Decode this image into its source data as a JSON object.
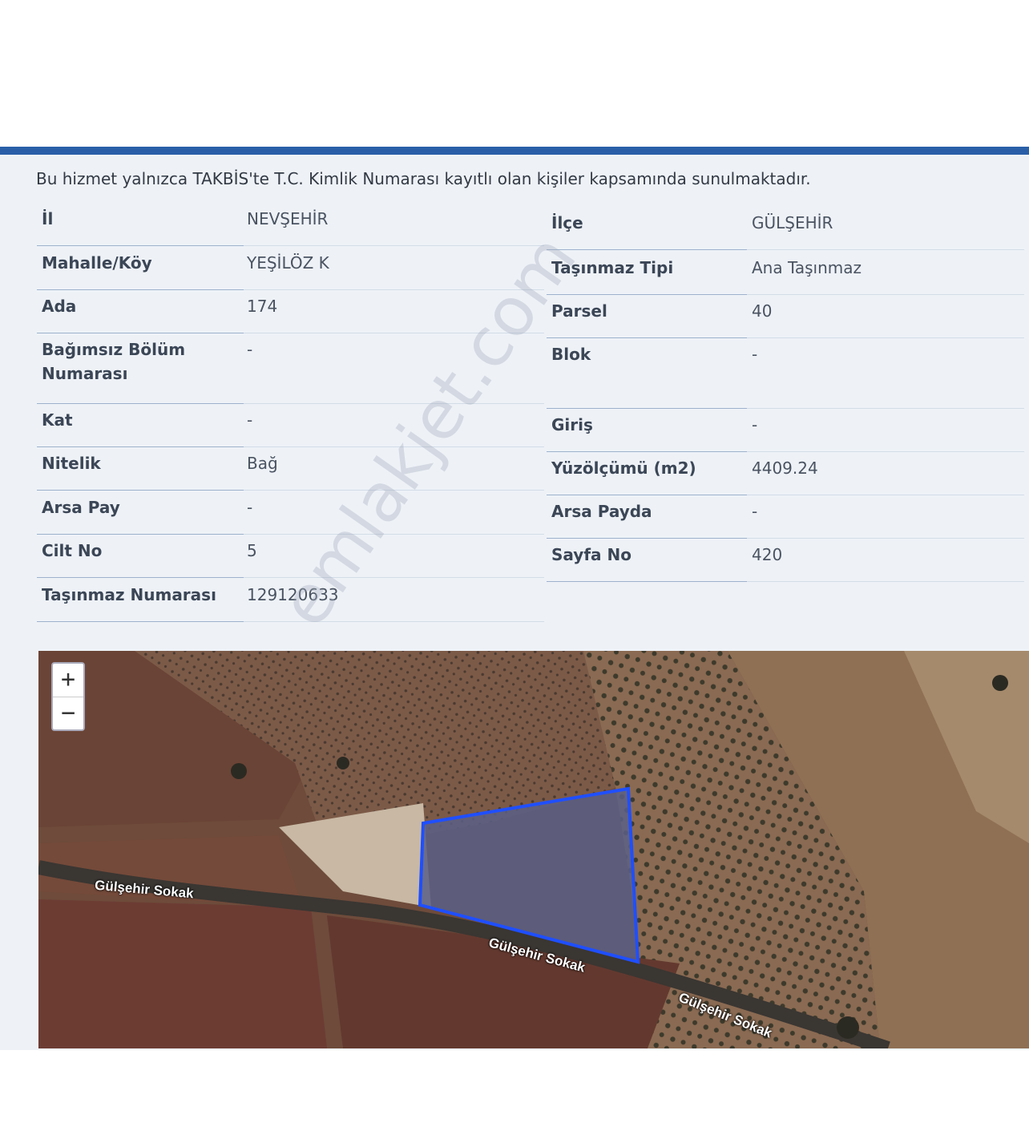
{
  "notice": "Bu hizmet yalnızca TAKBİS'te T.C. Kimlik Numarası kayıtlı olan kişiler kapsamında sunulmaktadır.",
  "left_fields": [
    {
      "label": "İl",
      "value": "NEVŞEHİR"
    },
    {
      "label": "Mahalle/Köy",
      "value": "YEŞİLÖZ K"
    },
    {
      "label": "Ada",
      "value": "174"
    },
    {
      "label": "Bağımsız Bölüm Numarası",
      "value": "-"
    },
    {
      "label": "Kat",
      "value": "-"
    },
    {
      "label": "Nitelik",
      "value": "Bağ"
    },
    {
      "label": "Arsa Pay",
      "value": "-"
    },
    {
      "label": "Cilt No",
      "value": "5"
    },
    {
      "label": "Taşınmaz Numarası",
      "value": "129120633"
    }
  ],
  "right_fields": [
    {
      "label": "İlçe",
      "value": "GÜLŞEHİR"
    },
    {
      "label": "Taşınmaz Tipi",
      "value": "Ana Taşınmaz"
    },
    {
      "label": "Parsel",
      "value": "40"
    },
    {
      "label": "Blok",
      "value": "-"
    },
    {
      "label": "Giriş",
      "value": "-"
    },
    {
      "label": "Yüzölçümü (m2)",
      "value": "4409.24"
    },
    {
      "label": "Arsa Payda",
      "value": "-"
    },
    {
      "label": "Sayfa No",
      "value": "420"
    }
  ],
  "watermark": "emlakjet.com",
  "map": {
    "zoom_in": "+",
    "zoom_out": "−",
    "road_labels": [
      "Gülşehir Sokak",
      "Gülşehir Sokak",
      "Gülşehir Sokak"
    ],
    "parcel_color": "#1f4fff",
    "theme_color": "#2a5fa8"
  }
}
